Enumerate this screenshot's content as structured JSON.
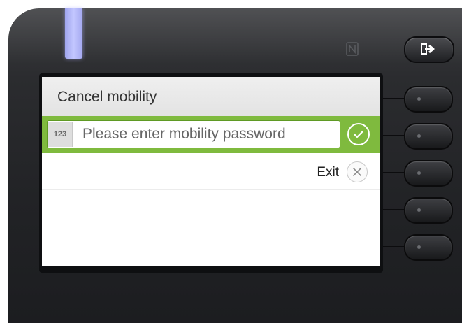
{
  "device": {
    "led_color": "#b0b4f8",
    "nfc_icon": "nfc-icon",
    "exit_key_icon": "exit-arrow-icon"
  },
  "screen": {
    "title": "Cancel mobility",
    "input": {
      "mode": "123",
      "placeholder": "Please enter mobility password",
      "value": ""
    },
    "confirm_icon": "checkmark-icon",
    "exit_label": "Exit",
    "exit_icon": "close-icon"
  },
  "colors": {
    "accent_green": "#7fba3e",
    "header_bg": "#e8e8e8"
  }
}
